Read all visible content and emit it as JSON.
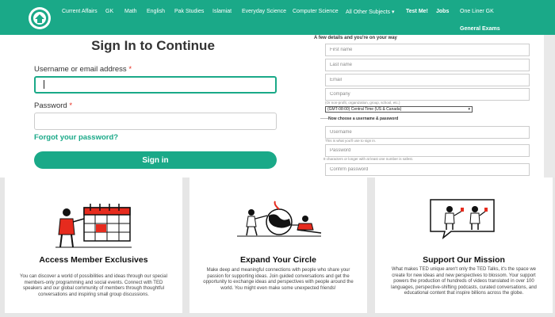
{
  "nav": {
    "items": [
      {
        "label": "Current Affairs",
        "bold": false
      },
      {
        "label": "GK",
        "bold": false
      },
      {
        "label": "Math",
        "bold": false
      },
      {
        "label": "English",
        "bold": false
      },
      {
        "label": "Pak Studies",
        "bold": false
      },
      {
        "label": "Islamiat",
        "bold": false
      },
      {
        "label": "Everyday Science",
        "bold": false
      },
      {
        "label": "Computer Science",
        "bold": false
      },
      {
        "label": "All Other Subjects ▾",
        "bold": false
      },
      {
        "label": "Test Me!",
        "bold": true
      },
      {
        "label": "Jobs",
        "bold": true
      },
      {
        "label": "One Liner GK",
        "bold": false
      },
      {
        "label": "General Exams",
        "bold": true
      }
    ],
    "accent": "#1aa988"
  },
  "signin": {
    "title": "Sign In to Continue",
    "username_label": "Username or email address",
    "username_value": "",
    "password_label": "Password",
    "password_value": "",
    "required_mark": "*",
    "forgot": "Forgot your password?",
    "button": "Sign in"
  },
  "register": {
    "heading": "A few details and you're on your way",
    "first_name": "First name",
    "last_name": "Last name",
    "email": "Email",
    "company": "Company",
    "company_hint": "(Or non-profit, organization, group, school, etc.)",
    "timezone": "(GMT-08:00) Central Time (US & Canada)",
    "section2": "Now choose a username & password",
    "username": "Username",
    "username_hint": "This is what you'll use to sign in.",
    "password": "Password",
    "password_hint": "8 characters or longer with at least one number is safest.",
    "confirm": "Confirm password"
  },
  "cards": [
    {
      "title": "Access Member Exclusives",
      "text": "You can discover a world of possibilities and ideas through our special members-only programming and social events. Connect with TED speakers and our global community of members through thoughtful conversations and inspiring small group discussions."
    },
    {
      "title": "Expand Your Circle",
      "text": "Make deep and meaningful connections with people who share your passion for supporting ideas. Join guided conversations and get the opportunity to exchange ideas and perspectives with people around the world. You might even make some unexpected friends!"
    },
    {
      "title": "Support Our Mission",
      "text": "What makes TED unique aren't only the TED Talks, it's the space we create for new ideas and new perspectives to blossom. Your support powers the production of hundreds of videos translated in over 100 languages, perspective-shifting podcasts, curated conversations, and educational content that inspire billions across the globe."
    }
  ]
}
